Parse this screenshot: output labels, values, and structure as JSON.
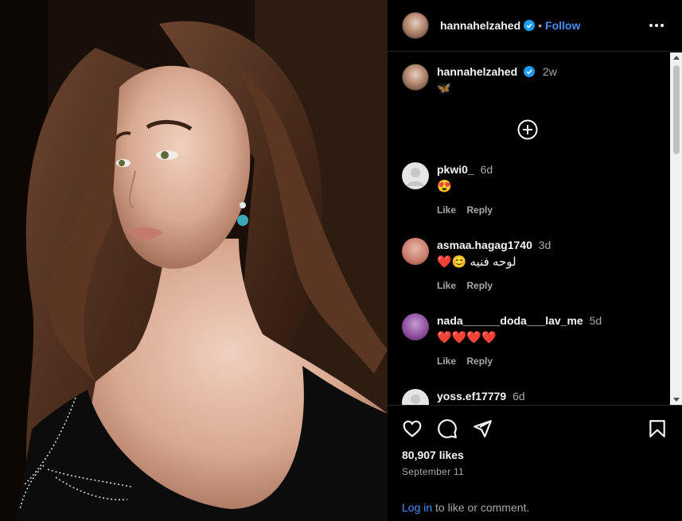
{
  "post": {
    "author": "hannahelzahed",
    "follow_label": "Follow",
    "separator": "•",
    "caption_text": "🦋",
    "caption_time": "2w",
    "likes": "80,907 likes",
    "date": "September 11"
  },
  "comments": [
    {
      "user": "pkwi0_",
      "time": "6d",
      "text": "😍",
      "avatar_color": "#e5e5e5"
    },
    {
      "user": "asmaa.hagag1740",
      "time": "3d",
      "text": "لوحه فنيه 😊❤️",
      "avatar_color": "#c87a6a"
    },
    {
      "user": "nada______doda___lav_me",
      "time": "5d",
      "text": "❤️❤️❤️❤️",
      "avatar_color": "#8a4a9a"
    },
    {
      "user": "yoss.ef17779",
      "time": "6d",
      "text": "",
      "avatar_color": "#e5e5e5"
    }
  ],
  "comment_actions": {
    "like": "Like",
    "reply": "Reply"
  },
  "footer": {
    "login_link": "Log in",
    "login_rest": " to like or comment."
  },
  "icons": {
    "more": "more-options-icon",
    "verified": "verified-badge-icon",
    "load_more": "plus-circle-icon",
    "like": "heart-icon",
    "comment": "comment-icon",
    "share": "share-icon",
    "save": "bookmark-icon"
  },
  "colors": {
    "accent": "#4a8cf7",
    "verified": "#1d9bf0",
    "muted": "#a8a8a8"
  }
}
